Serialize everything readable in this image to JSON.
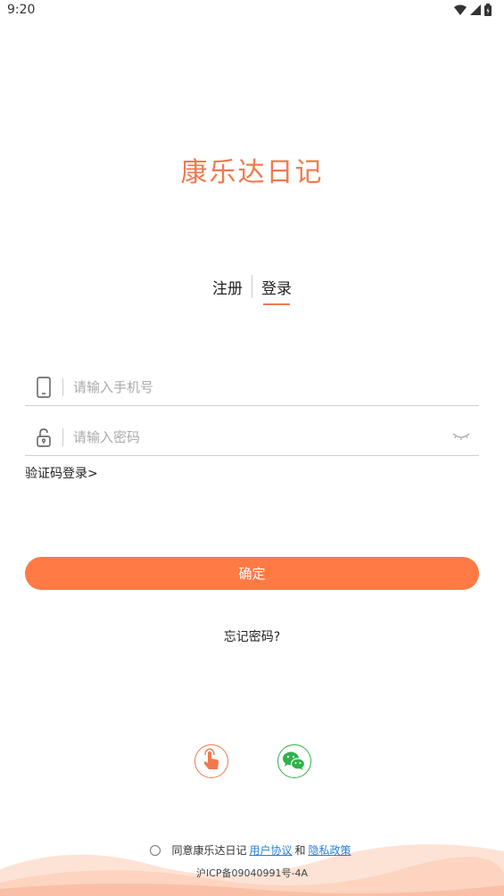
{
  "status_bar": {
    "time": "9:20"
  },
  "app": {
    "title": "康乐达日记"
  },
  "tabs": [
    {
      "label": "注册",
      "active": false
    },
    {
      "label": "登录",
      "active": true
    }
  ],
  "phone_field": {
    "placeholder": "请输入手机号",
    "value": ""
  },
  "password_field": {
    "placeholder": "请输入密码",
    "value": ""
  },
  "sms_login_link": "验证码登录>",
  "confirm_button": "确定",
  "forgot_password": "忘记密码?",
  "social": [
    {
      "icon": "touch-hand-icon",
      "color": "#f07a4e"
    },
    {
      "icon": "wechat-icon",
      "color": "#2db34a"
    }
  ],
  "agreement": {
    "prefix": "同意康乐达日记",
    "user_agreement": "用户协议",
    "conjunction": "和",
    "privacy_policy": "隐私政策"
  },
  "icp": "沪ICP备09040991号-4A",
  "colors": {
    "accent": "#ff7a45",
    "link": "#2a7fd8",
    "wechat": "#2db34a"
  }
}
